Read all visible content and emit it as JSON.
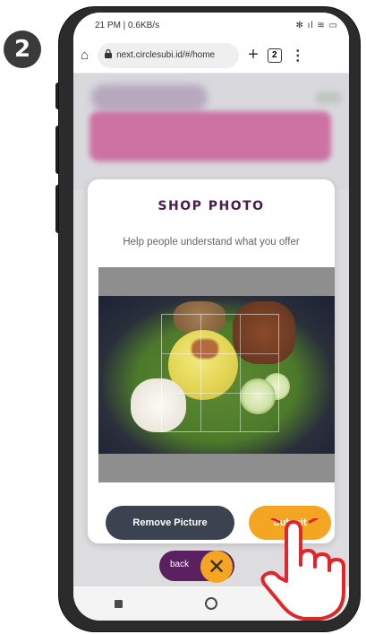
{
  "step_badge": "2",
  "status_bar": {
    "left": "21 PM | 0.6KB/s",
    "right": "✻ ıl ≋ ▭"
  },
  "browser": {
    "url": "next.circlesubi.id/#/home",
    "tab_count": "2"
  },
  "modal": {
    "title": "SHOP PHOTO",
    "subtitle": "Help people understand what you offer",
    "remove_label": "Remove Picture",
    "submit_label": "Submit"
  },
  "footer": {
    "back_label": "back"
  },
  "colors": {
    "brand_purple": "#4a1d4e",
    "accent_orange": "#f4a623",
    "button_dark": "#3b4350",
    "back_purple": "#5a2060"
  },
  "icons": [
    "home-icon",
    "lock-icon",
    "plus-icon",
    "tabs-icon",
    "more-icon",
    "close-icon",
    "hand-pointer-icon"
  ]
}
